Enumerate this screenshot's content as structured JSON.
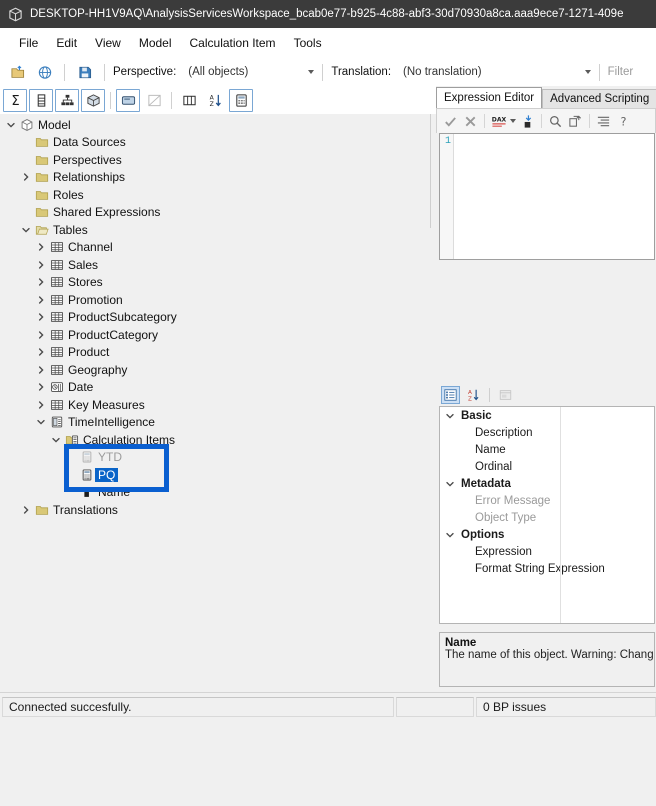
{
  "window": {
    "icon": "app-cube-icon",
    "title": "DESKTOP-HH1V9AQ\\AnalysisServicesWorkspace_bcab0e77-b925-4c88-abf3-30d70930a8ca.aaa9ece7-1271-409e"
  },
  "menu": {
    "items": [
      {
        "label": "File"
      },
      {
        "label": "Edit"
      },
      {
        "label": "View"
      },
      {
        "label": "Model"
      },
      {
        "label": "Calculation Item"
      },
      {
        "label": "Tools"
      }
    ]
  },
  "toolbar_top": {
    "buttons": [
      {
        "name": "open-file-icon"
      },
      {
        "name": "connect-globe-icon"
      },
      {
        "name": "save-icon"
      }
    ],
    "perspective_label": "Perspective:",
    "perspective_value": "(All objects)",
    "translation_label": "Translation:",
    "translation_value": "(No translation)",
    "filter_placeholder": "Filter"
  },
  "toolbar_second": {
    "buttons": [
      {
        "name": "measure-sigma-icon"
      },
      {
        "name": "column-icon"
      },
      {
        "name": "hierarchy-icon"
      },
      {
        "name": "kpi-cube-icon"
      },
      {
        "name": "table-view-icon"
      },
      {
        "name": "diagram-icon"
      },
      {
        "name": "columns-icon"
      },
      {
        "name": "sort-az-icon"
      },
      {
        "name": "calc-group-icon"
      }
    ]
  },
  "tree": {
    "nodes": [
      {
        "label": "Model",
        "indent": 0,
        "icon": "model-cube-icon",
        "expander": "down",
        "selected": false
      },
      {
        "label": "Data Sources",
        "indent": 1,
        "icon": "folder-icon",
        "expander": "none",
        "selected": false
      },
      {
        "label": "Perspectives",
        "indent": 1,
        "icon": "folder-icon",
        "expander": "none",
        "selected": false
      },
      {
        "label": "Relationships",
        "indent": 1,
        "icon": "folder-icon",
        "expander": "right",
        "selected": false
      },
      {
        "label": "Roles",
        "indent": 1,
        "icon": "folder-icon",
        "expander": "none",
        "selected": false
      },
      {
        "label": "Shared Expressions",
        "indent": 1,
        "icon": "folder-icon",
        "expander": "none",
        "selected": false
      },
      {
        "label": "Tables",
        "indent": 1,
        "icon": "folder-open-icon",
        "expander": "down",
        "selected": false
      },
      {
        "label": "Channel",
        "indent": 2,
        "icon": "table-icon",
        "expander": "right",
        "selected": false
      },
      {
        "label": "Sales",
        "indent": 2,
        "icon": "table-icon",
        "expander": "right",
        "selected": false
      },
      {
        "label": "Stores",
        "indent": 2,
        "icon": "table-icon",
        "expander": "right",
        "selected": false
      },
      {
        "label": "Promotion",
        "indent": 2,
        "icon": "table-icon",
        "expander": "right",
        "selected": false
      },
      {
        "label": "ProductSubcategory",
        "indent": 2,
        "icon": "table-icon",
        "expander": "right",
        "selected": false
      },
      {
        "label": "ProductCategory",
        "indent": 2,
        "icon": "table-icon",
        "expander": "right",
        "selected": false
      },
      {
        "label": "Product",
        "indent": 2,
        "icon": "table-icon",
        "expander": "right",
        "selected": false
      },
      {
        "label": "Geography",
        "indent": 2,
        "icon": "table-icon",
        "expander": "right",
        "selected": false
      },
      {
        "label": "Date",
        "indent": 2,
        "icon": "date-table-icon",
        "expander": "right",
        "selected": false
      },
      {
        "label": "Key Measures",
        "indent": 2,
        "icon": "table-icon",
        "expander": "right",
        "selected": false
      },
      {
        "label": "TimeIntelligence",
        "indent": 2,
        "icon": "calc-group-icon",
        "expander": "down",
        "selected": false
      },
      {
        "label": "Calculation Items",
        "indent": 3,
        "icon": "calc-items-icon",
        "expander": "down",
        "selected": false
      }
    ],
    "obscured_item": {
      "label": "YTD",
      "icon": "calc-item-icon"
    },
    "highlighted": [
      {
        "label": "PQ",
        "icon": "calc-item-icon",
        "selected": true
      },
      {
        "label": "Name",
        "icon": "rename-field-icon",
        "selected": false
      }
    ],
    "trailing": [
      {
        "label": "Translations",
        "indent": 1,
        "icon": "folder-icon",
        "expander": "right",
        "selected": false
      }
    ],
    "annotation_color": "#0a5fd0",
    "selection_color": "#0a64c8"
  },
  "right_panel": {
    "tabs": [
      {
        "label": "Expression Editor",
        "active": true
      },
      {
        "label": "Advanced Scripting",
        "active": false
      }
    ],
    "editor_toolbar": [
      {
        "name": "accept-check-icon"
      },
      {
        "name": "cancel-x-icon"
      },
      {
        "name": "dax-format-icon"
      },
      {
        "name": "dax-format-dropdown-icon"
      },
      {
        "name": "insert-reference-icon"
      },
      {
        "name": "find-icon"
      },
      {
        "name": "replace-icon"
      },
      {
        "name": "indent-icon"
      },
      {
        "name": "help-icon"
      }
    ],
    "editor": {
      "line_number": "1",
      "content": ""
    },
    "properties_toolbar": [
      {
        "name": "categorized-view-icon",
        "active": true
      },
      {
        "name": "sort-alpha-icon",
        "active": false
      },
      {
        "name": "property-pages-icon",
        "active": false,
        "disabled": true
      }
    ],
    "properties": [
      {
        "label": "Basic",
        "type": "group",
        "value": ""
      },
      {
        "label": "Description",
        "type": "item",
        "value": ""
      },
      {
        "label": "Name",
        "type": "item",
        "value": ""
      },
      {
        "label": "Ordinal",
        "type": "item",
        "value": ""
      },
      {
        "label": "Metadata",
        "type": "group",
        "value": ""
      },
      {
        "label": "Error Message",
        "type": "item",
        "value": "",
        "disabled": true
      },
      {
        "label": "Object Type",
        "type": "item",
        "value": "",
        "disabled": true
      },
      {
        "label": "Options",
        "type": "group",
        "value": ""
      },
      {
        "label": "Expression",
        "type": "item",
        "value": ""
      },
      {
        "label": "Format String Expression",
        "type": "item",
        "value": ""
      }
    ],
    "description": {
      "title": "Name",
      "text": "The name of this object. Warning: Changin"
    }
  },
  "statusbar": {
    "connection": "Connected succesfully.",
    "middle": "",
    "issues": "0 BP issues"
  }
}
